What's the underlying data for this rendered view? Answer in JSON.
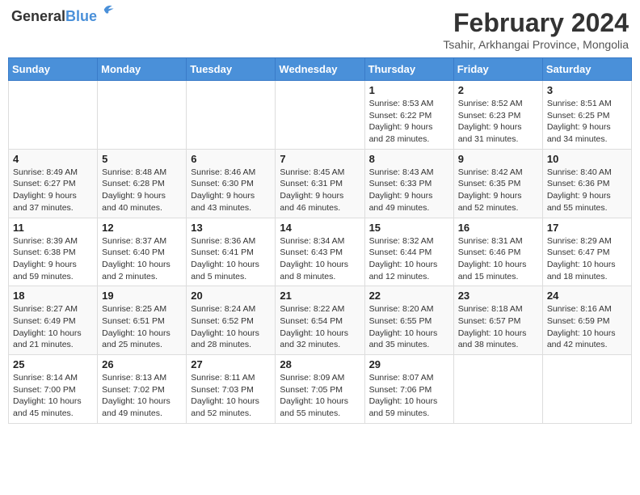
{
  "logo": {
    "general": "General",
    "blue": "Blue"
  },
  "header": {
    "month_year": "February 2024",
    "location": "Tsahir, Arkhangai Province, Mongolia"
  },
  "weekdays": [
    "Sunday",
    "Monday",
    "Tuesday",
    "Wednesday",
    "Thursday",
    "Friday",
    "Saturday"
  ],
  "weeks": [
    [
      {
        "day": "",
        "info": ""
      },
      {
        "day": "",
        "info": ""
      },
      {
        "day": "",
        "info": ""
      },
      {
        "day": "",
        "info": ""
      },
      {
        "day": "1",
        "info": "Sunrise: 8:53 AM\nSunset: 6:22 PM\nDaylight: 9 hours and 28 minutes."
      },
      {
        "day": "2",
        "info": "Sunrise: 8:52 AM\nSunset: 6:23 PM\nDaylight: 9 hours and 31 minutes."
      },
      {
        "day": "3",
        "info": "Sunrise: 8:51 AM\nSunset: 6:25 PM\nDaylight: 9 hours and 34 minutes."
      }
    ],
    [
      {
        "day": "4",
        "info": "Sunrise: 8:49 AM\nSunset: 6:27 PM\nDaylight: 9 hours and 37 minutes."
      },
      {
        "day": "5",
        "info": "Sunrise: 8:48 AM\nSunset: 6:28 PM\nDaylight: 9 hours and 40 minutes."
      },
      {
        "day": "6",
        "info": "Sunrise: 8:46 AM\nSunset: 6:30 PM\nDaylight: 9 hours and 43 minutes."
      },
      {
        "day": "7",
        "info": "Sunrise: 8:45 AM\nSunset: 6:31 PM\nDaylight: 9 hours and 46 minutes."
      },
      {
        "day": "8",
        "info": "Sunrise: 8:43 AM\nSunset: 6:33 PM\nDaylight: 9 hours and 49 minutes."
      },
      {
        "day": "9",
        "info": "Sunrise: 8:42 AM\nSunset: 6:35 PM\nDaylight: 9 hours and 52 minutes."
      },
      {
        "day": "10",
        "info": "Sunrise: 8:40 AM\nSunset: 6:36 PM\nDaylight: 9 hours and 55 minutes."
      }
    ],
    [
      {
        "day": "11",
        "info": "Sunrise: 8:39 AM\nSunset: 6:38 PM\nDaylight: 9 hours and 59 minutes."
      },
      {
        "day": "12",
        "info": "Sunrise: 8:37 AM\nSunset: 6:40 PM\nDaylight: 10 hours and 2 minutes."
      },
      {
        "day": "13",
        "info": "Sunrise: 8:36 AM\nSunset: 6:41 PM\nDaylight: 10 hours and 5 minutes."
      },
      {
        "day": "14",
        "info": "Sunrise: 8:34 AM\nSunset: 6:43 PM\nDaylight: 10 hours and 8 minutes."
      },
      {
        "day": "15",
        "info": "Sunrise: 8:32 AM\nSunset: 6:44 PM\nDaylight: 10 hours and 12 minutes."
      },
      {
        "day": "16",
        "info": "Sunrise: 8:31 AM\nSunset: 6:46 PM\nDaylight: 10 hours and 15 minutes."
      },
      {
        "day": "17",
        "info": "Sunrise: 8:29 AM\nSunset: 6:47 PM\nDaylight: 10 hours and 18 minutes."
      }
    ],
    [
      {
        "day": "18",
        "info": "Sunrise: 8:27 AM\nSunset: 6:49 PM\nDaylight: 10 hours and 21 minutes."
      },
      {
        "day": "19",
        "info": "Sunrise: 8:25 AM\nSunset: 6:51 PM\nDaylight: 10 hours and 25 minutes."
      },
      {
        "day": "20",
        "info": "Sunrise: 8:24 AM\nSunset: 6:52 PM\nDaylight: 10 hours and 28 minutes."
      },
      {
        "day": "21",
        "info": "Sunrise: 8:22 AM\nSunset: 6:54 PM\nDaylight: 10 hours and 32 minutes."
      },
      {
        "day": "22",
        "info": "Sunrise: 8:20 AM\nSunset: 6:55 PM\nDaylight: 10 hours and 35 minutes."
      },
      {
        "day": "23",
        "info": "Sunrise: 8:18 AM\nSunset: 6:57 PM\nDaylight: 10 hours and 38 minutes."
      },
      {
        "day": "24",
        "info": "Sunrise: 8:16 AM\nSunset: 6:59 PM\nDaylight: 10 hours and 42 minutes."
      }
    ],
    [
      {
        "day": "25",
        "info": "Sunrise: 8:14 AM\nSunset: 7:00 PM\nDaylight: 10 hours and 45 minutes."
      },
      {
        "day": "26",
        "info": "Sunrise: 8:13 AM\nSunset: 7:02 PM\nDaylight: 10 hours and 49 minutes."
      },
      {
        "day": "27",
        "info": "Sunrise: 8:11 AM\nSunset: 7:03 PM\nDaylight: 10 hours and 52 minutes."
      },
      {
        "day": "28",
        "info": "Sunrise: 8:09 AM\nSunset: 7:05 PM\nDaylight: 10 hours and 55 minutes."
      },
      {
        "day": "29",
        "info": "Sunrise: 8:07 AM\nSunset: 7:06 PM\nDaylight: 10 hours and 59 minutes."
      },
      {
        "day": "",
        "info": ""
      },
      {
        "day": "",
        "info": ""
      }
    ]
  ]
}
